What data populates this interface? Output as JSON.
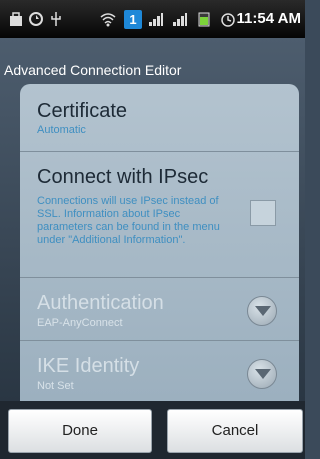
{
  "status_bar": {
    "time": "11:54 AM",
    "icons": [
      "bag-icon",
      "sync-icon",
      "usb-icon",
      "wifi-icon",
      "notification-1-icon",
      "signal-icon",
      "signal-icon",
      "battery-icon",
      "alarm-icon"
    ],
    "notification_count": "1"
  },
  "dialog": {
    "title": "Advanced Connection Editor",
    "certificate": {
      "label": "Certificate",
      "value": "Automatic"
    },
    "ipsec": {
      "label": "Connect with IPsec",
      "description": "Connections will use IPsec instead of SSL. Information about IPsec parameters can be found in the menu under \"Additional Information\".",
      "checked": false
    },
    "authentication": {
      "label": "Authentication",
      "value": "EAP-AnyConnect"
    },
    "ike_identity": {
      "label": "IKE Identity",
      "value": "Not Set"
    }
  },
  "buttons": {
    "done": "Done",
    "cancel": "Cancel"
  },
  "colors": {
    "accent": "#3f8fc1",
    "panel": "#b3c3cf",
    "disabled_text": "#d5dfe6"
  }
}
